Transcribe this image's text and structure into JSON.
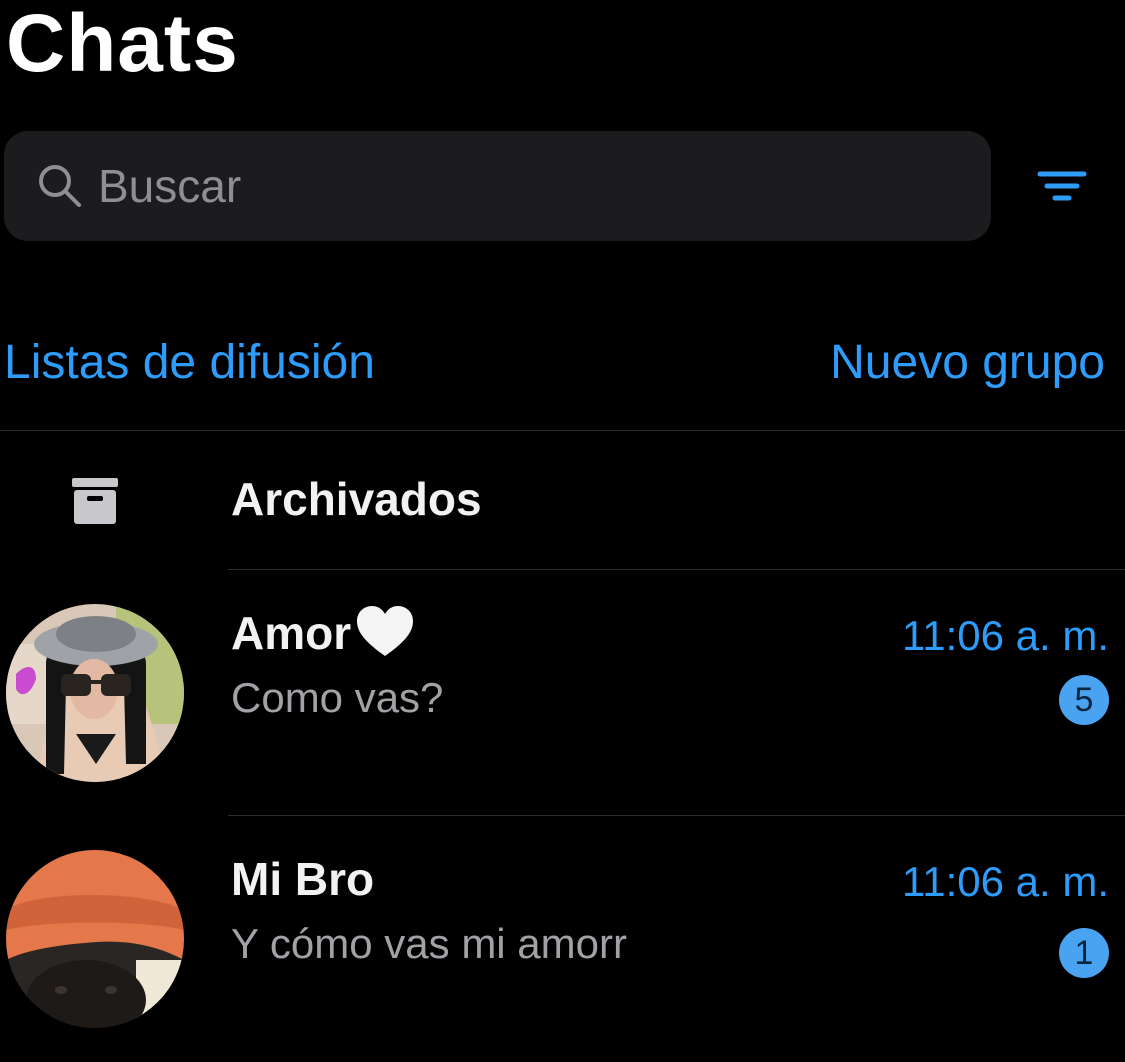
{
  "header": {
    "title": "Chats"
  },
  "search": {
    "placeholder": "Buscar",
    "icon": "search-icon"
  },
  "filter": {
    "icon": "filter-icon"
  },
  "actions": {
    "broadcast_lists": "Listas de difusión",
    "new_group": "Nuevo grupo"
  },
  "archived": {
    "label": "Archivados",
    "icon": "archive-icon"
  },
  "chats": [
    {
      "name": "Amor",
      "name_emoji": "white-heart-emoji",
      "last_message": "Como vas?",
      "time": "11:06 a. m.",
      "unread": "5"
    },
    {
      "name": "Mi Bro",
      "last_message": "Y cómo vas mi amorr",
      "time": "11:06 a. m.",
      "unread": "1"
    }
  ],
  "colors": {
    "background": "#000000",
    "accent": "#2e9cfb",
    "badge": "#4aa3f0",
    "search_bg": "#1c1c1e",
    "secondary_text": "#a1a1a6"
  }
}
